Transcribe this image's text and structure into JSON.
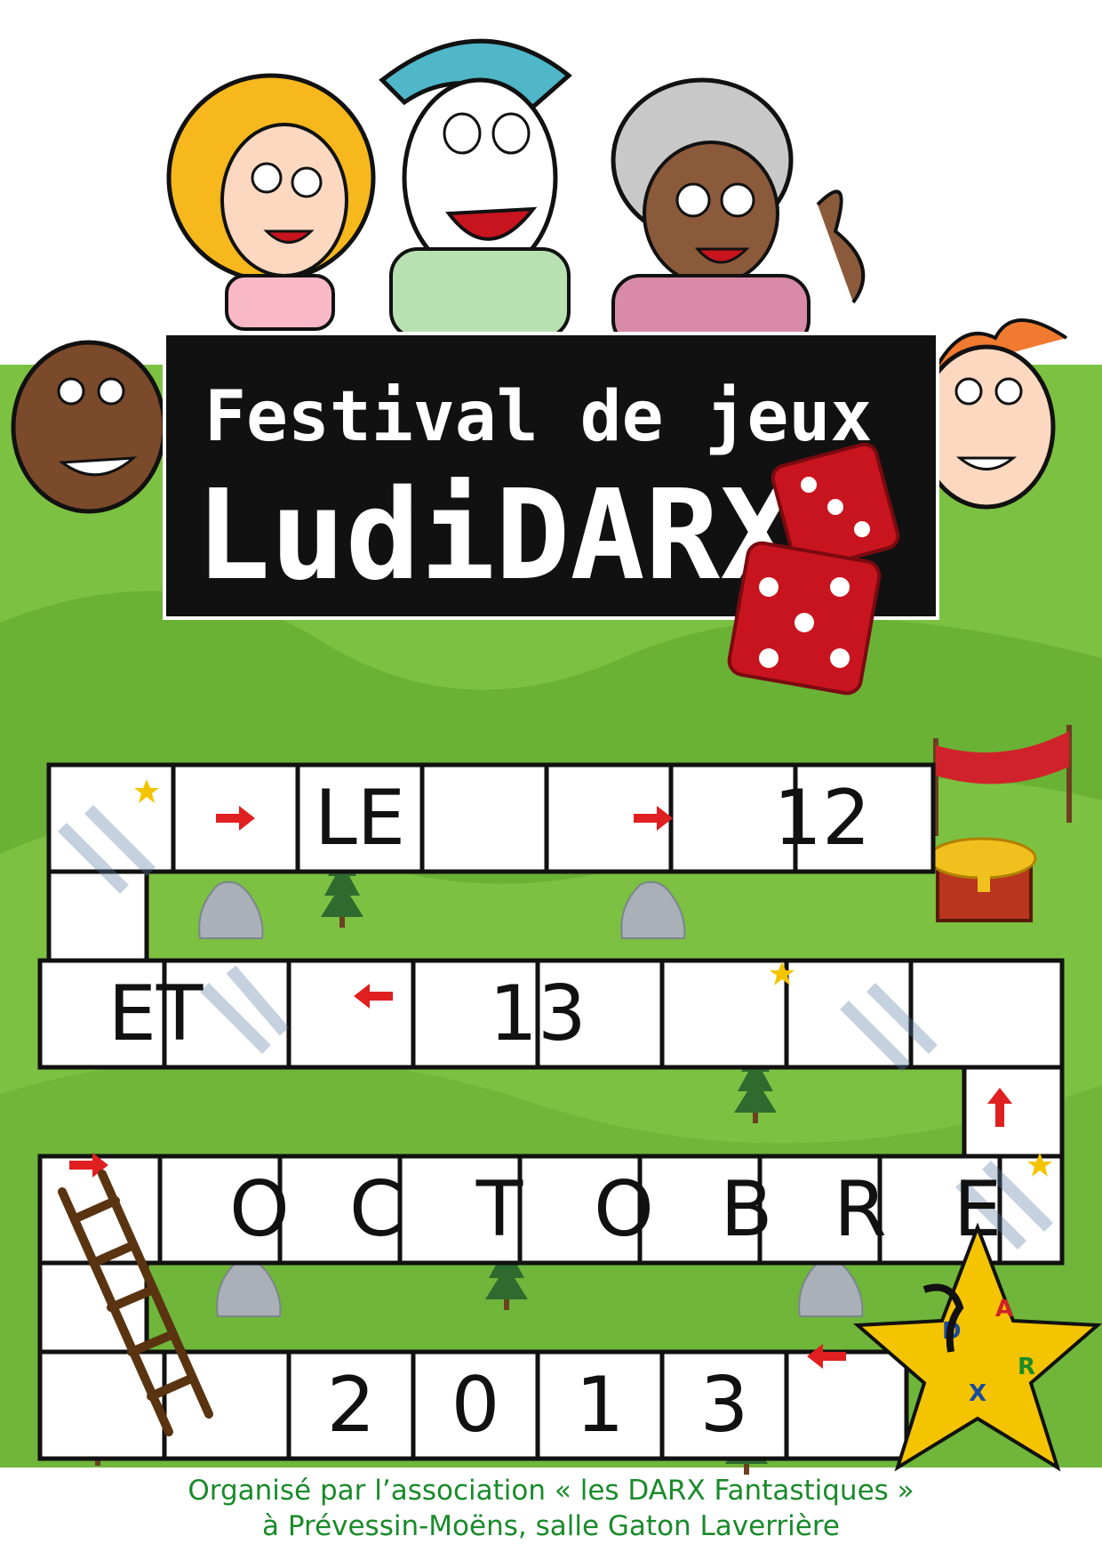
{
  "title": {
    "line1": "Festival de jeux",
    "line2": "LudiDARX"
  },
  "board": {
    "row1": [
      "LE",
      "12"
    ],
    "row2": [
      "ET",
      "13"
    ],
    "row3": [
      "O",
      "C",
      "T",
      "O",
      "B",
      "R",
      "E"
    ],
    "row4": [
      "2",
      "0",
      "1",
      "3"
    ]
  },
  "logo": {
    "letters": [
      "D",
      "A",
      "R",
      "X"
    ]
  },
  "footer": {
    "line1": "Organisé par l’association « les DARX Fantastiques »",
    "line2": "à Prévessin-Moëns, salle Gaton Laverrière"
  },
  "colors": {
    "grass": "#7cc142",
    "grass_dark": "#5aa02c",
    "title_bg": "#111111",
    "arrow": "#e02020",
    "dice": "#c8141e",
    "star": "#f4c400",
    "footer_text": "#1a8a2a"
  },
  "icons": [
    "dice-icon",
    "star-icon",
    "arrow-right-icon",
    "arrow-left-icon",
    "arrow-up-icon",
    "ladder-icon",
    "tree-icon",
    "rock-icon",
    "treasure-chest-icon",
    "banner-icon",
    "cartoon-character"
  ]
}
